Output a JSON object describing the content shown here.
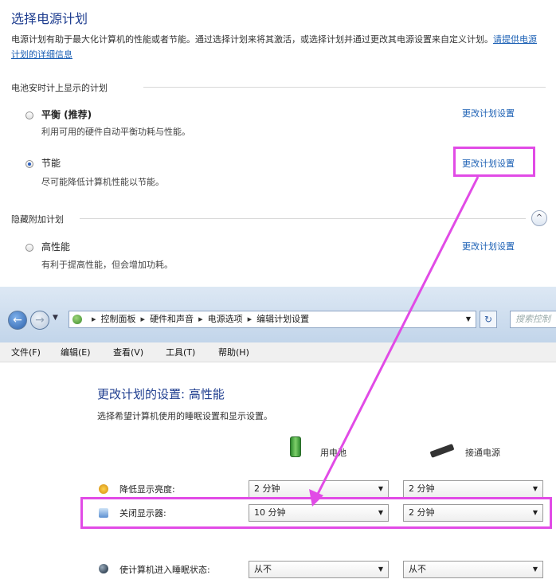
{
  "top": {
    "title": "选择电源计划",
    "description": "电源计划有助于最大化计算机的性能或者节能。通过选择计划来将其激活，或选择计划并通过更改其电源设置来自定义计划。",
    "learn_more_link": "请提供电源计划的详细信息",
    "section_battery": "电池安时计上显示的计划",
    "section_hidden": "隐藏附加计划",
    "collapse_symbol": "^",
    "plans": [
      {
        "name": "平衡 (推荐)",
        "desc": "利用可用的硬件自动平衡功耗与性能。",
        "selected": false,
        "change": "更改计划设置"
      },
      {
        "name": "节能",
        "desc": "尽可能降低计算机性能以节能。",
        "selected": true,
        "change": "更改计划设置"
      },
      {
        "name": "高性能",
        "desc": "有利于提高性能，但会增加功耗。",
        "selected": false,
        "change": "更改计划设置"
      }
    ]
  },
  "explorer": {
    "breadcrumbs": [
      "控制面板",
      "硬件和声音",
      "电源选项",
      "编辑计划设置"
    ],
    "search_placeholder": "搜索控制",
    "menu": [
      "文件(F)",
      "编辑(E)",
      "查看(V)",
      "工具(T)",
      "帮助(H)"
    ],
    "heading": "更改计划的设置: 高性能",
    "subheading": "选择希望计算机使用的睡眠设置和显示设置。",
    "col_battery": "用电池",
    "col_plugged": "接通电源",
    "rows": [
      {
        "label": "降低显示亮度:",
        "battery": "2 分钟",
        "plugged": "2 分钟"
      },
      {
        "label": "关闭显示器:",
        "battery": "10 分钟",
        "plugged": "2 分钟"
      },
      {
        "label": "使计算机进入睡眠状态:",
        "battery": "从不",
        "plugged": "从不"
      }
    ]
  },
  "colors": {
    "annotation": "#e14be6",
    "heading": "#1e3d8f",
    "link": "#1a5fb4"
  }
}
